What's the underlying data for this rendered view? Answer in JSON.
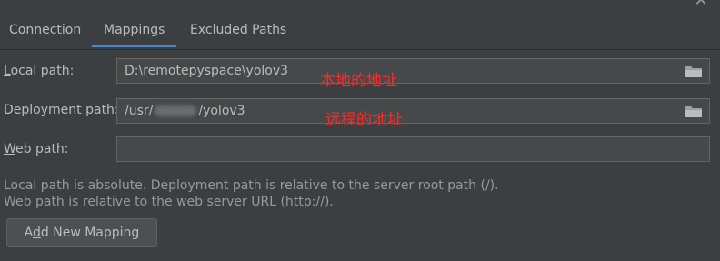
{
  "tabs": [
    {
      "label": "Connection"
    },
    {
      "label": "Mappings"
    },
    {
      "label": "Excluded Paths"
    }
  ],
  "fields": {
    "local_path": {
      "label_ul": "L",
      "label_rest": "ocal path:",
      "value": "D:\\remotepyspace\\yolov3",
      "annotation": "本地的地址"
    },
    "deployment_path": {
      "label_pre": "D",
      "label_ul": "e",
      "label_rest": "ployment path:",
      "value_prefix": "/usr/",
      "value_suffix": "/yolov3",
      "annotation": "远程的地址"
    },
    "web_path": {
      "label_ul": "W",
      "label_rest": "eb path:",
      "value": ""
    }
  },
  "help": {
    "line1": "Local path is absolute. Deployment path is relative to the server root path (/).",
    "line2": "Web path is relative to the web server URL (http://)."
  },
  "add_button": {
    "pre": "A",
    "ul": "d",
    "rest": "d New Mapping"
  },
  "icons": {
    "close": "close-icon",
    "folder": "folder-icon"
  },
  "colors": {
    "accent": "#4a88c7",
    "annotation": "#ff2a2a"
  }
}
